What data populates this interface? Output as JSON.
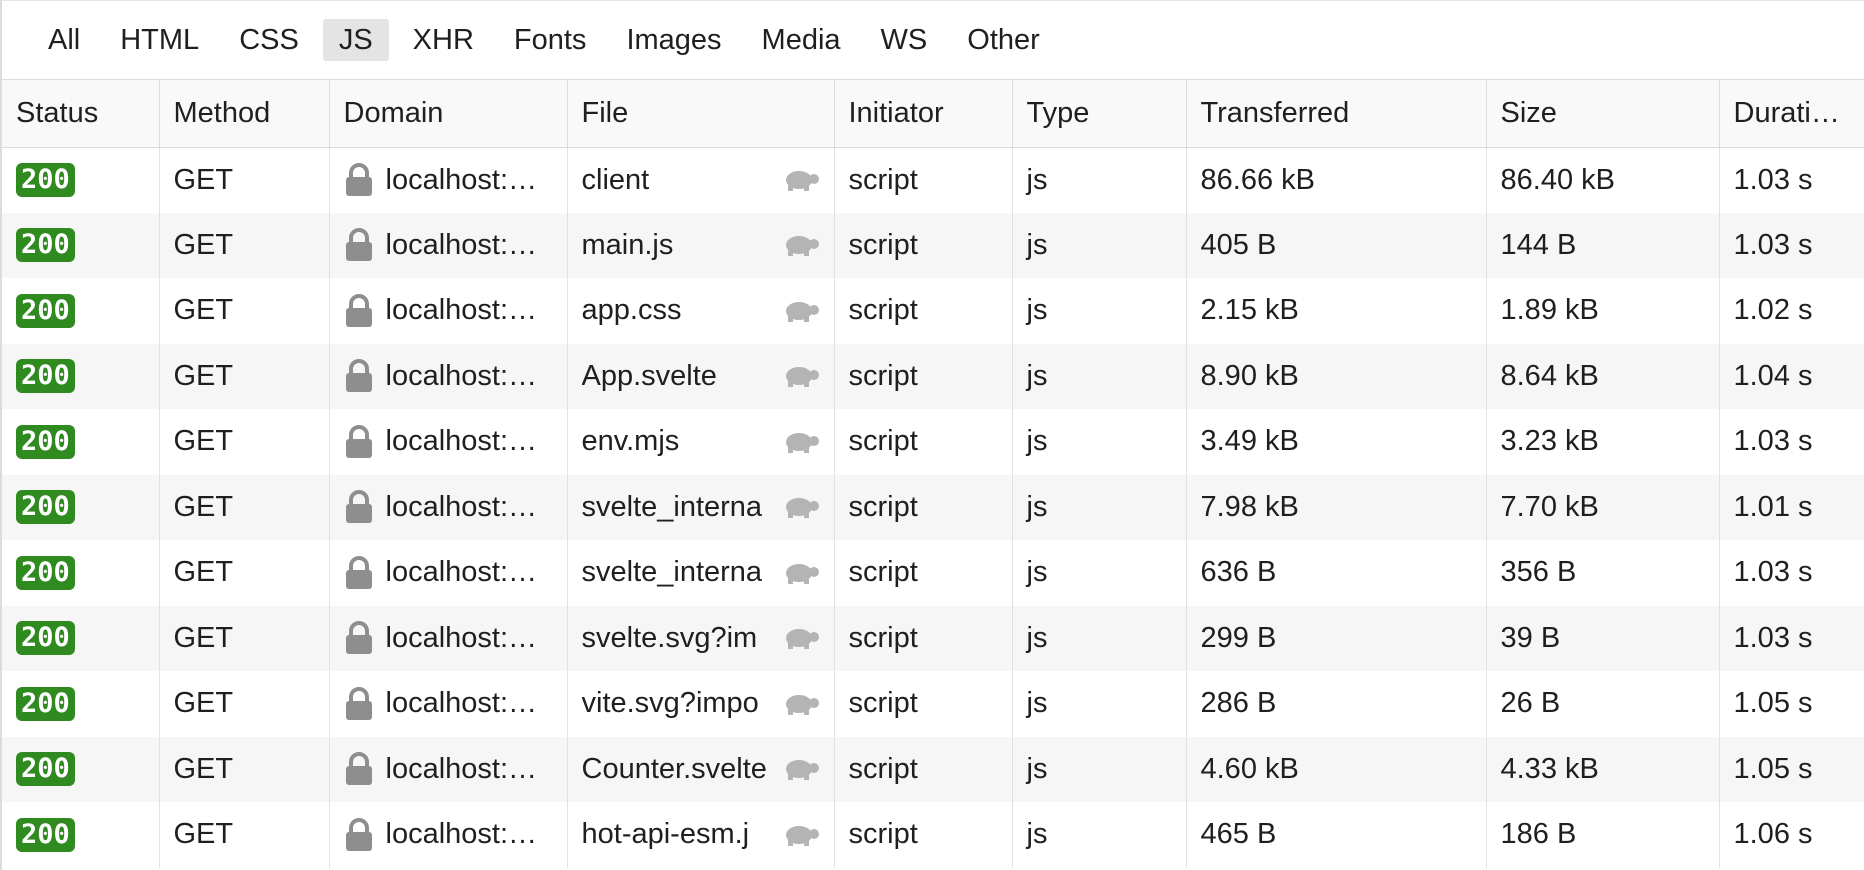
{
  "filters": [
    {
      "label": "All",
      "active": false
    },
    {
      "label": "HTML",
      "active": false
    },
    {
      "label": "CSS",
      "active": false
    },
    {
      "label": "JS",
      "active": true
    },
    {
      "label": "XHR",
      "active": false
    },
    {
      "label": "Fonts",
      "active": false
    },
    {
      "label": "Images",
      "active": false
    },
    {
      "label": "Media",
      "active": false
    },
    {
      "label": "WS",
      "active": false
    },
    {
      "label": "Other",
      "active": false
    }
  ],
  "columns": [
    "Status",
    "Method",
    "Domain",
    "File",
    "Initiator",
    "Type",
    "Transferred",
    "Size",
    "Durati…"
  ],
  "rows": [
    {
      "status": "200",
      "method": "GET",
      "domain": "localhost:…",
      "file": "client",
      "initiator": "script",
      "type": "js",
      "transferred": "86.66 kB",
      "size": "86.40 kB",
      "duration": "1.03 s"
    },
    {
      "status": "200",
      "method": "GET",
      "domain": "localhost:…",
      "file": "main.js",
      "initiator": "script",
      "type": "js",
      "transferred": "405 B",
      "size": "144 B",
      "duration": "1.03 s"
    },
    {
      "status": "200",
      "method": "GET",
      "domain": "localhost:…",
      "file": "app.css",
      "initiator": "script",
      "type": "js",
      "transferred": "2.15 kB",
      "size": "1.89 kB",
      "duration": "1.02 s"
    },
    {
      "status": "200",
      "method": "GET",
      "domain": "localhost:…",
      "file": "App.svelte",
      "initiator": "script",
      "type": "js",
      "transferred": "8.90 kB",
      "size": "8.64 kB",
      "duration": "1.04 s"
    },
    {
      "status": "200",
      "method": "GET",
      "domain": "localhost:…",
      "file": "env.mjs",
      "initiator": "script",
      "type": "js",
      "transferred": "3.49 kB",
      "size": "3.23 kB",
      "duration": "1.03 s"
    },
    {
      "status": "200",
      "method": "GET",
      "domain": "localhost:…",
      "file": "svelte_interna",
      "initiator": "script",
      "type": "js",
      "transferred": "7.98 kB",
      "size": "7.70 kB",
      "duration": "1.01 s"
    },
    {
      "status": "200",
      "method": "GET",
      "domain": "localhost:…",
      "file": "svelte_interna",
      "initiator": "script",
      "type": "js",
      "transferred": "636 B",
      "size": "356 B",
      "duration": "1.03 s"
    },
    {
      "status": "200",
      "method": "GET",
      "domain": "localhost:…",
      "file": "svelte.svg?im",
      "initiator": "script",
      "type": "js",
      "transferred": "299 B",
      "size": "39 B",
      "duration": "1.03 s"
    },
    {
      "status": "200",
      "method": "GET",
      "domain": "localhost:…",
      "file": "vite.svg?impo",
      "initiator": "script",
      "type": "js",
      "transferred": "286 B",
      "size": "26 B",
      "duration": "1.05 s"
    },
    {
      "status": "200",
      "method": "GET",
      "domain": "localhost:…",
      "file": "Counter.svelte",
      "initiator": "script",
      "type": "js",
      "transferred": "4.60 kB",
      "size": "4.33 kB",
      "duration": "1.05 s"
    },
    {
      "status": "200",
      "method": "GET",
      "domain": "localhost:…",
      "file": "hot-api-esm.j",
      "initiator": "script",
      "type": "js",
      "transferred": "465 B",
      "size": "186 B",
      "duration": "1.06 s"
    }
  ],
  "icons": {
    "lock": "lock-icon",
    "slow": "turtle-icon"
  },
  "colors": {
    "status_ok": "#2f8a1f",
    "active_filter": "#e4e4e4",
    "stripe": "#f6f6f6",
    "icon_gray": "#8e8e8e"
  }
}
